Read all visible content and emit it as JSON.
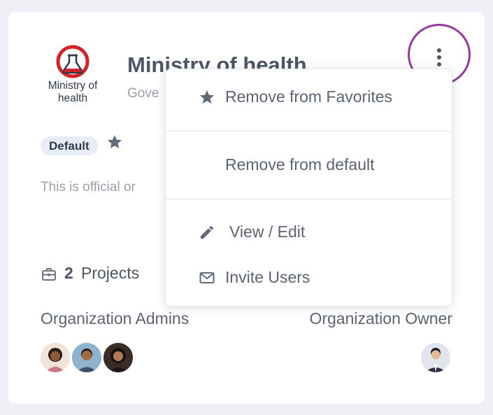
{
  "organization": {
    "logo_line1": "Ministry of",
    "logo_line2": "health",
    "name": "Ministry of health",
    "subtitle": "Gove",
    "badge": "Default",
    "description": "This is official or",
    "projects_count": "2",
    "projects_label": "Projects",
    "admins_label": "Organization Admins",
    "owner_label": "Organization Owner"
  },
  "menu": {
    "items": [
      {
        "label": "Remove from Favorites",
        "icon": "star-icon"
      },
      {
        "label": "Remove from default",
        "icon": ""
      },
      {
        "label": "View / Edit",
        "icon": "pencil-icon"
      },
      {
        "label": "Invite Users",
        "icon": "mail-icon"
      }
    ]
  },
  "colors": {
    "annotation_circle": "#933c9d",
    "logo_red": "#d2232a",
    "text_dark": "#4b5563",
    "text_muted": "#9aa1ab"
  }
}
